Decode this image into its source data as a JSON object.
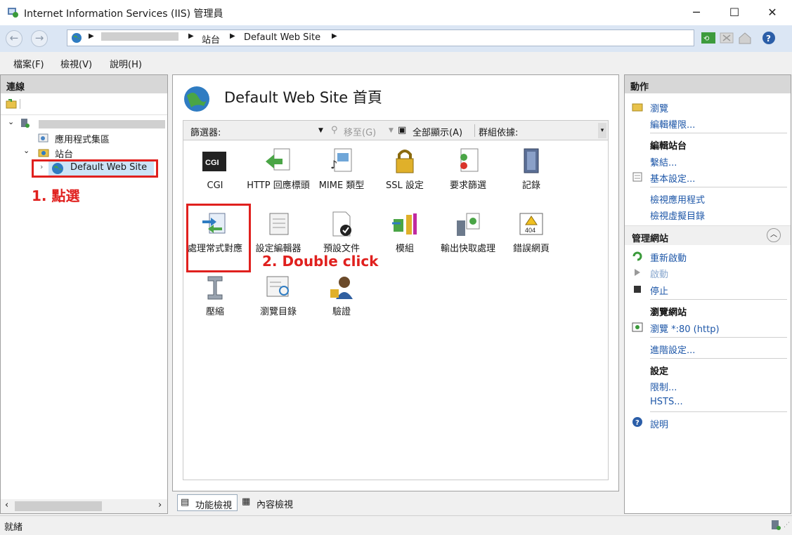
{
  "window": {
    "title": "Internet Information Services (IIS) 管理員",
    "minimize": "─",
    "maximize": "☐",
    "close": "✕"
  },
  "address": {
    "crumbs": [
      "站台",
      "Default Web Site"
    ]
  },
  "menu": {
    "items": [
      "檔案(F)",
      "檢視(V)",
      "說明(H)"
    ]
  },
  "left": {
    "header": "連線",
    "tree": {
      "app_pools": "應用程式集區",
      "sites": "站台",
      "default_site": "Default Web Site"
    }
  },
  "center": {
    "title": "Default Web Site 首頁",
    "filter": {
      "label": "篩選器:",
      "go": "移至(G)",
      "show_all": "全部顯示(A)",
      "group_by": "群組依據:"
    },
    "features": [
      {
        "label": "CGI",
        "icon": "cgi-icon"
      },
      {
        "label": "HTTP 回應標頭",
        "icon": "http-headers-icon"
      },
      {
        "label": "MIME 類型",
        "icon": "mime-icon"
      },
      {
        "label": "SSL 設定",
        "icon": "ssl-lock-icon"
      },
      {
        "label": "要求篩選",
        "icon": "request-filter-icon"
      },
      {
        "label": "記錄",
        "icon": "logging-icon"
      },
      {
        "label": "處理常式對應",
        "icon": "handler-mappings-icon"
      },
      {
        "label": "設定編輯器",
        "icon": "config-editor-icon"
      },
      {
        "label": "預設文件",
        "icon": "default-document-icon"
      },
      {
        "label": "模組",
        "icon": "modules-icon"
      },
      {
        "label": "輸出快取處理",
        "icon": "output-cache-icon"
      },
      {
        "label": "錯誤網頁",
        "icon": "error-pages-icon"
      },
      {
        "label": "壓縮",
        "icon": "compression-icon"
      },
      {
        "label": "瀏覽目錄",
        "icon": "directory-browsing-icon"
      },
      {
        "label": "驗證",
        "icon": "authentication-icon"
      }
    ],
    "tabs": {
      "features_view": "功能檢視",
      "content_view": "內容檢視"
    }
  },
  "annotations": {
    "step1": "1. 點選",
    "step2": "2. Double click"
  },
  "actions": {
    "header": "動作",
    "explore": "瀏覽",
    "edit_permissions": "編輯權限...",
    "edit_site": "編輯站台",
    "bindings": "繫結...",
    "basic_settings": "基本設定...",
    "view_apps": "檢視應用程式",
    "view_vdirs": "檢視虛擬目錄",
    "manage_site": "管理網站",
    "restart": "重新啟動",
    "start": "啟動",
    "stop": "停止",
    "browse_site": "瀏覽網站",
    "browse_80": "瀏覽 *:80 (http)",
    "advanced": "進階設定...",
    "config": "設定",
    "limits": "限制...",
    "hsts": "HSTS...",
    "help": "說明"
  },
  "status": {
    "text": "就緒"
  },
  "colors": {
    "accent": "#1e57a8",
    "highlight_red": "#e0201e"
  }
}
